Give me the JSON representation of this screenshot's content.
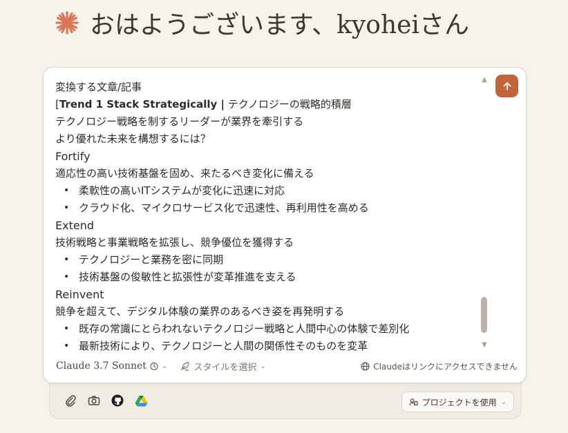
{
  "greeting": {
    "text": "おはようございます、kyoheiさん"
  },
  "colors": {
    "accent": "#c4643d",
    "background": "#f5f3ec"
  },
  "composer": {
    "lines": [
      {
        "type": "text",
        "text": "変換する文章/記事"
      },
      {
        "type": "title",
        "prefix": "[",
        "bold": "Trend 1 Stack Strategically |",
        "rest": " テクノロジーの戦略的積層"
      },
      {
        "type": "text",
        "text": "テクノロジー戦略を制するリーダーが業界を牽引する"
      },
      {
        "type": "text",
        "text": "より優れた未来を構想するには？"
      },
      {
        "type": "heading",
        "text": "Fortify"
      },
      {
        "type": "text",
        "text": "適応性の高い技術基盤を固め、来たるべき変化に備える"
      },
      {
        "type": "bullet",
        "text": "柔軟性の高いITシステムが変化に迅速に対応"
      },
      {
        "type": "bullet",
        "text": "クラウド化、マイクロサービス化で迅速性、再利用性を高める"
      },
      {
        "type": "heading",
        "text": "Extend"
      },
      {
        "type": "text",
        "text": "技術戦略と事業戦略を拡張し、競争優位を獲得する"
      },
      {
        "type": "bullet",
        "text": "テクノロジーと業務を密に同期"
      },
      {
        "type": "bullet",
        "text": "技術基盤の俊敏性と拡張性が変革推進を支える"
      },
      {
        "type": "heading",
        "text": "Reinvent"
      },
      {
        "type": "text",
        "text": "競争を超えて、デジタル体験の業界のあるべき姿を再発明する"
      },
      {
        "type": "bullet",
        "text": "既存の常識にとらわれないテクノロジー戦略と人間中心の体験で差別化"
      },
      {
        "type": "bullet",
        "text": "最新技術により、テクノロジーと人間の関係性そのものを変革"
      }
    ],
    "send_icon": "arrow-up-icon"
  },
  "toolbar": {
    "model_label": "Claude 3.7 Sonnet",
    "style_label": "スタイルを選択",
    "link_notice": "Claudeはリンクにアクセスできません"
  },
  "tray": {
    "icons": [
      "paperclip-icon",
      "camera-icon",
      "github-icon",
      "google-drive-icon"
    ],
    "project_label": "プロジェクトを使用"
  }
}
